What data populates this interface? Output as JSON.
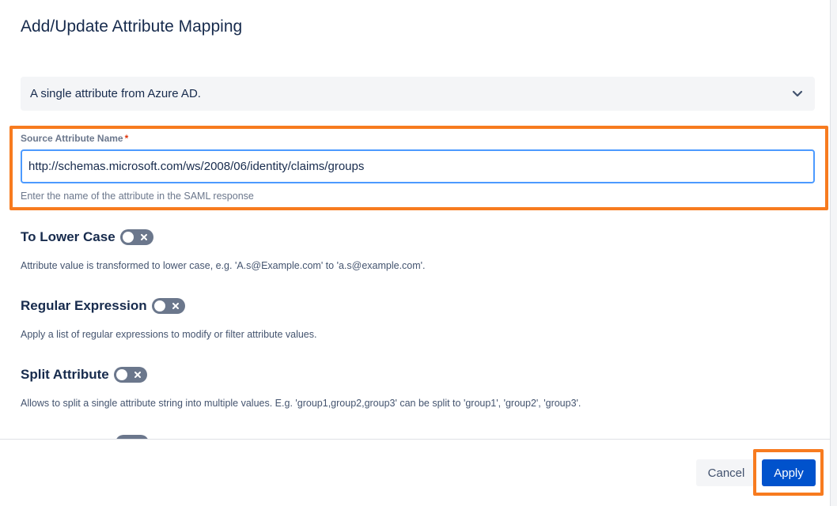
{
  "dialog": {
    "title": "Add/Update Attribute Mapping"
  },
  "source_select": {
    "value": "A single attribute from Azure AD."
  },
  "source_attribute": {
    "label": "Source Attribute Name",
    "required_mark": "*",
    "value": "http://schemas.microsoft.com/ws/2008/06/identity/claims/groups",
    "helper": "Enter the name of the attribute in the SAML response"
  },
  "options": [
    {
      "title": "To Lower Case",
      "enabled": false,
      "description": "Attribute value is transformed to lower case, e.g. 'A.s@Example.com' to 'a.s@example.com'."
    },
    {
      "title": "Regular Expression",
      "enabled": false,
      "description": "Apply a list of regular expressions to modify or filter attribute values."
    },
    {
      "title": "Split Attribute",
      "enabled": false,
      "description": "Allows to split a single attribute string into multiple values. E.g. 'group1,group2,group3' can be split to 'group1', 'group2', 'group3'."
    }
  ],
  "footer": {
    "cancel_label": "Cancel",
    "apply_label": "Apply"
  },
  "colors": {
    "highlight": "#f77b1f",
    "primary": "#0052cc",
    "toggle_off": "#6b778c",
    "input_focus": "#4c9aff"
  },
  "icons": {
    "select_chevron": "chevron-down-icon",
    "toggle_off": "close-icon"
  }
}
